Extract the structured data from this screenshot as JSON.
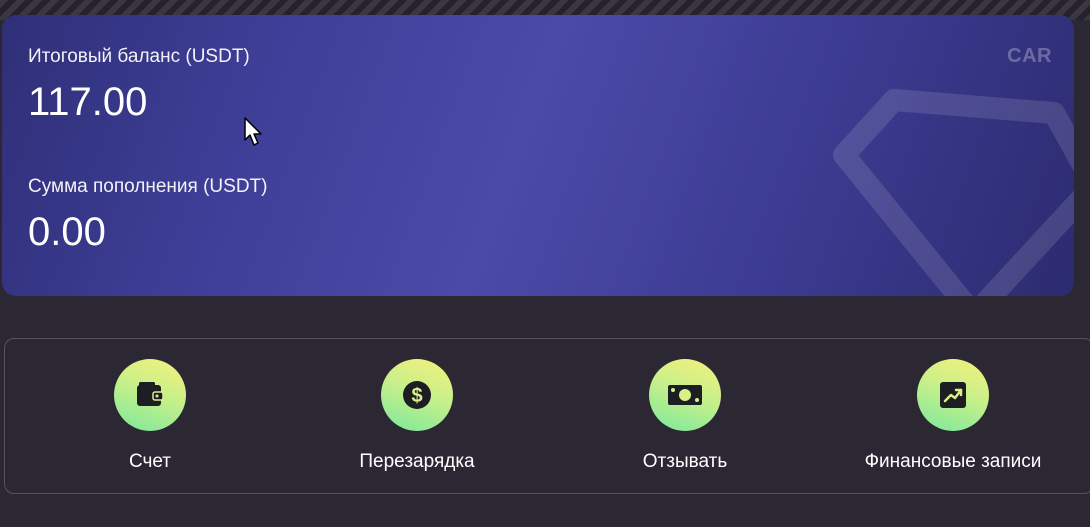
{
  "card": {
    "brand": "CAR",
    "total_balance_label": "Итоговый баланс (USDT)",
    "total_balance_value": "117.00",
    "deposit_label": "Сумма пополнения (USDT)",
    "deposit_value": "0.00"
  },
  "actions": [
    {
      "label": "Счет",
      "icon": "wallet-icon"
    },
    {
      "label": "Перезарядка",
      "icon": "dollar-coin-icon"
    },
    {
      "label": "Отзывать",
      "icon": "cash-icon"
    },
    {
      "label": "Финансовые записи",
      "icon": "chart-trend-icon"
    }
  ],
  "colors": {
    "page_background": "#2b2733",
    "card_gradient_mid": "#4b4aa8",
    "icon_gradient_top": "#f6f07c",
    "icon_gradient_bottom": "#7be89c",
    "icon_glyph": "#1d1d24"
  }
}
